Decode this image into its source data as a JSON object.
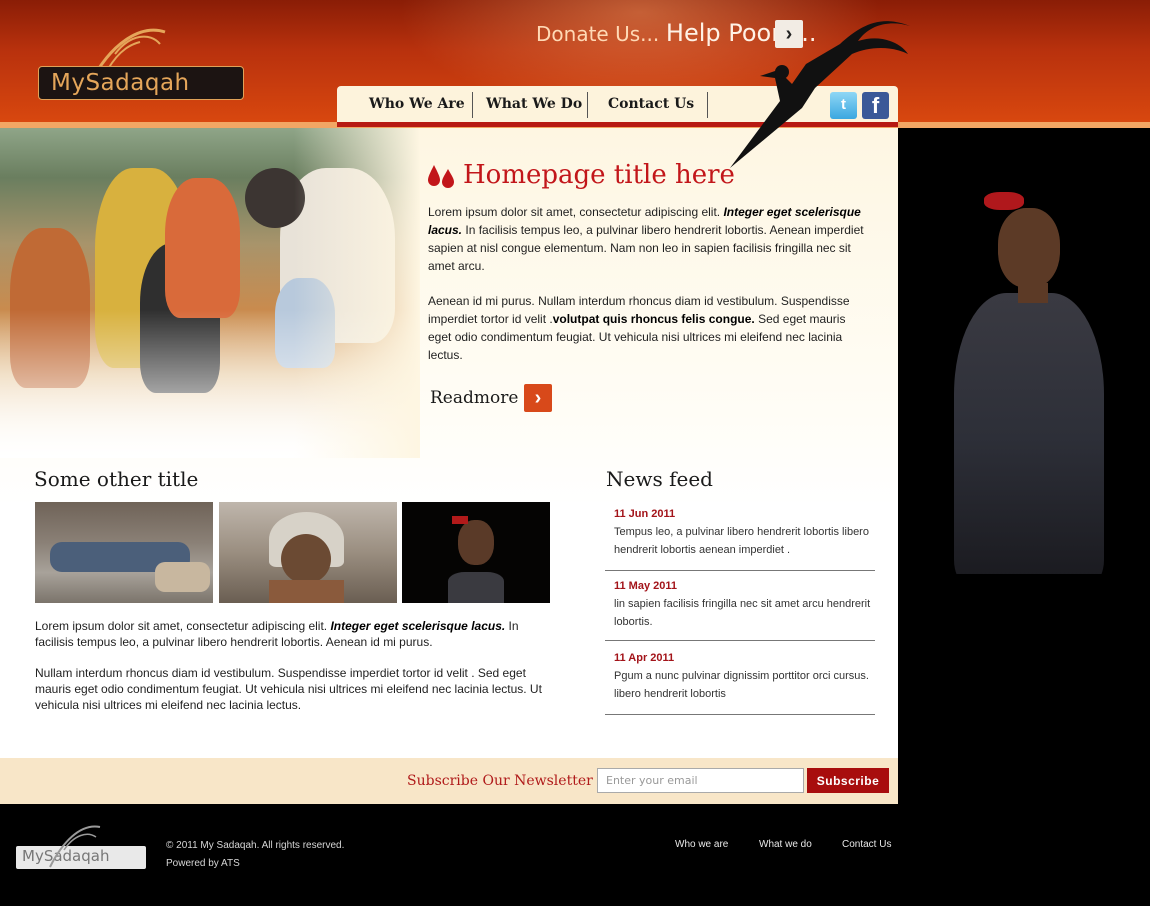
{
  "brand": {
    "logo_text": "MySadaqah",
    "accent": "#d9480f",
    "dark_red": "#b71a13"
  },
  "header": {
    "donate_a": "Donate Us...",
    "donate_b": "Help Poors...",
    "donate_arrow": "chevron-right-icon"
  },
  "nav": {
    "items": [
      {
        "label": "Who We Are"
      },
      {
        "label": "What We Do"
      },
      {
        "label": "Contact Us"
      }
    ],
    "social": [
      {
        "icon": "twitter-icon",
        "glyph": "t"
      },
      {
        "icon": "facebook-icon",
        "glyph": "f"
      }
    ]
  },
  "hero": {
    "title": "Homepage title here",
    "para1_pre": "Lorem ipsum dolor sit amet, consectetur adipiscing elit. ",
    "para1_bold": "Integer eget scelerisque lacus.",
    "para1_post": " In facilisis tempus leo, a pulvinar libero hendrerit lobortis. Aenean imperdiet sapien at nisl congue elementum. Nam non leo in sapien facilisis fringilla nec sit amet arcu.",
    "para2_pre": "Aenean id mi purus. Nullam interdum rhoncus diam id vestibulum. Suspendisse imperdiet tortor id velit .",
    "para2_bold": "volutpat quis rhoncus felis congue.",
    "para2_post": " Sed eget mauris eget odio condimentum feugiat. Ut vehicula nisi ultrices mi eleifend nec lacinia lectus.",
    "readmore": "Readmore"
  },
  "other": {
    "title": "Some other title",
    "para1_pre": "Lorem ipsum dolor sit amet, consectetur adipiscing elit. ",
    "para1_bold": "Integer eget scelerisque lacus.",
    "para1_post": " In facilisis tempus leo, a pulvinar libero hendrerit lobortis. Aenean id mi purus.",
    "para2": "Nullam interdum rhoncus diam id vestibulum. Suspendisse imperdiet tortor id velit . Sed eget mauris eget odio condimentum feugiat. Ut vehicula nisi ultrices mi eleifend nec lacinia lectus. Ut vehicula nisi ultrices mi eleifend nec lacinia lectus."
  },
  "news": {
    "title": "News feed",
    "items": [
      {
        "date": "11 Jun 2011",
        "text": "Tempus leo, a pulvinar libero hendrerit lobortis libero hendrerit lobortis aenean imperdiet ."
      },
      {
        "date": "11 May 2011",
        "text": "lin sapien facilisis fringilla nec sit amet arcu hendrerit lobortis."
      },
      {
        "date": "11 Apr 2011",
        "text": "Pgum a nunc pulvinar dignissim porttitor orci cursus. libero hendrerit lobortis"
      }
    ]
  },
  "subscribe": {
    "label": "Subscribe Our Newsletter",
    "placeholder": "Enter your email",
    "button": "Subscribe"
  },
  "footer": {
    "logo_text": "MySadaqah",
    "copyright": "© 2011 My Sadaqah. All rights reserved.",
    "powered": "Powered by ATS",
    "links": [
      {
        "label": "Who we are"
      },
      {
        "label": "What we do"
      },
      {
        "label": "Contact Us"
      }
    ]
  }
}
